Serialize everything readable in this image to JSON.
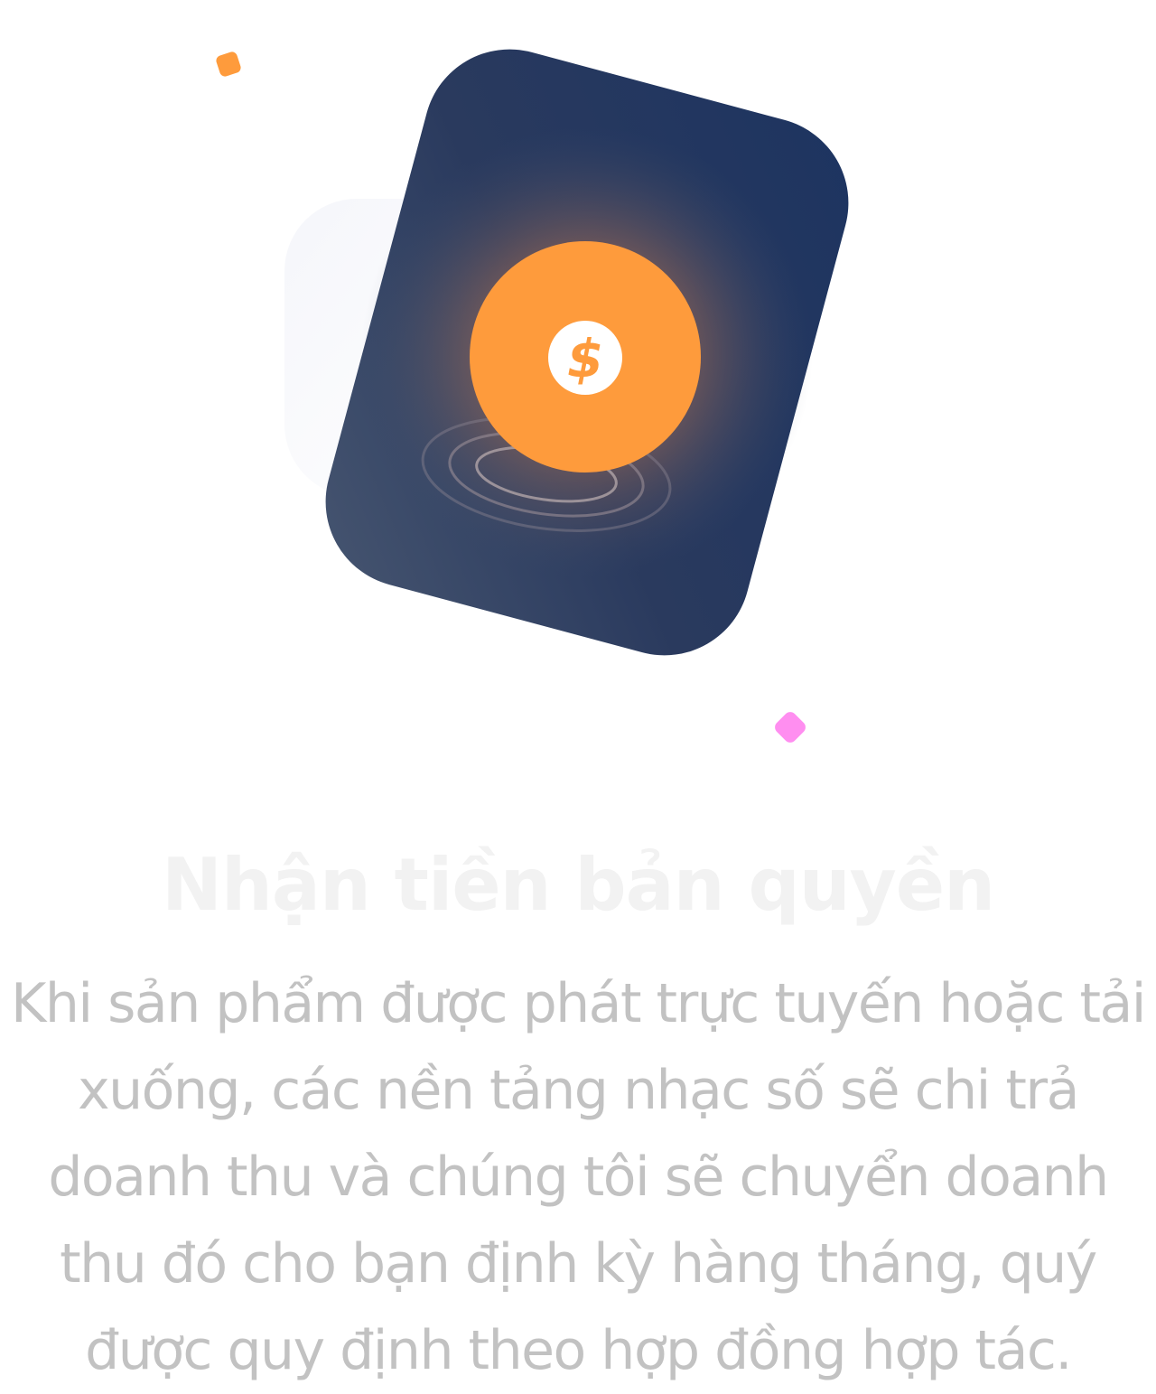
{
  "illustration": {
    "icon": "dollar-coin-icon",
    "card_colors": [
      "#1d3461",
      "#3f4d6b"
    ],
    "coin_color": "#fe9b3c",
    "coin_glow": "#ff9b3c",
    "dollar_symbol": "$",
    "decor_square_color": "#fe9b3c",
    "decor_diamond_color": "#ff8ef0"
  },
  "title": {
    "text": "Nhận tiền bản quyền",
    "color": "#f2f2f2"
  },
  "description": {
    "color": "#c2c2c2",
    "lines": [
      "Khi sản phẩm được phát trực tuyến hoặc tải",
      "xuống, các nền tảng nhạc số sẽ chi trả",
      "doanh thu và chúng tôi sẽ chuyển doanh",
      "thu đó cho bạn định kỳ hàng tháng, quý",
      "được quy định theo hợp đồng hợp tác."
    ]
  }
}
